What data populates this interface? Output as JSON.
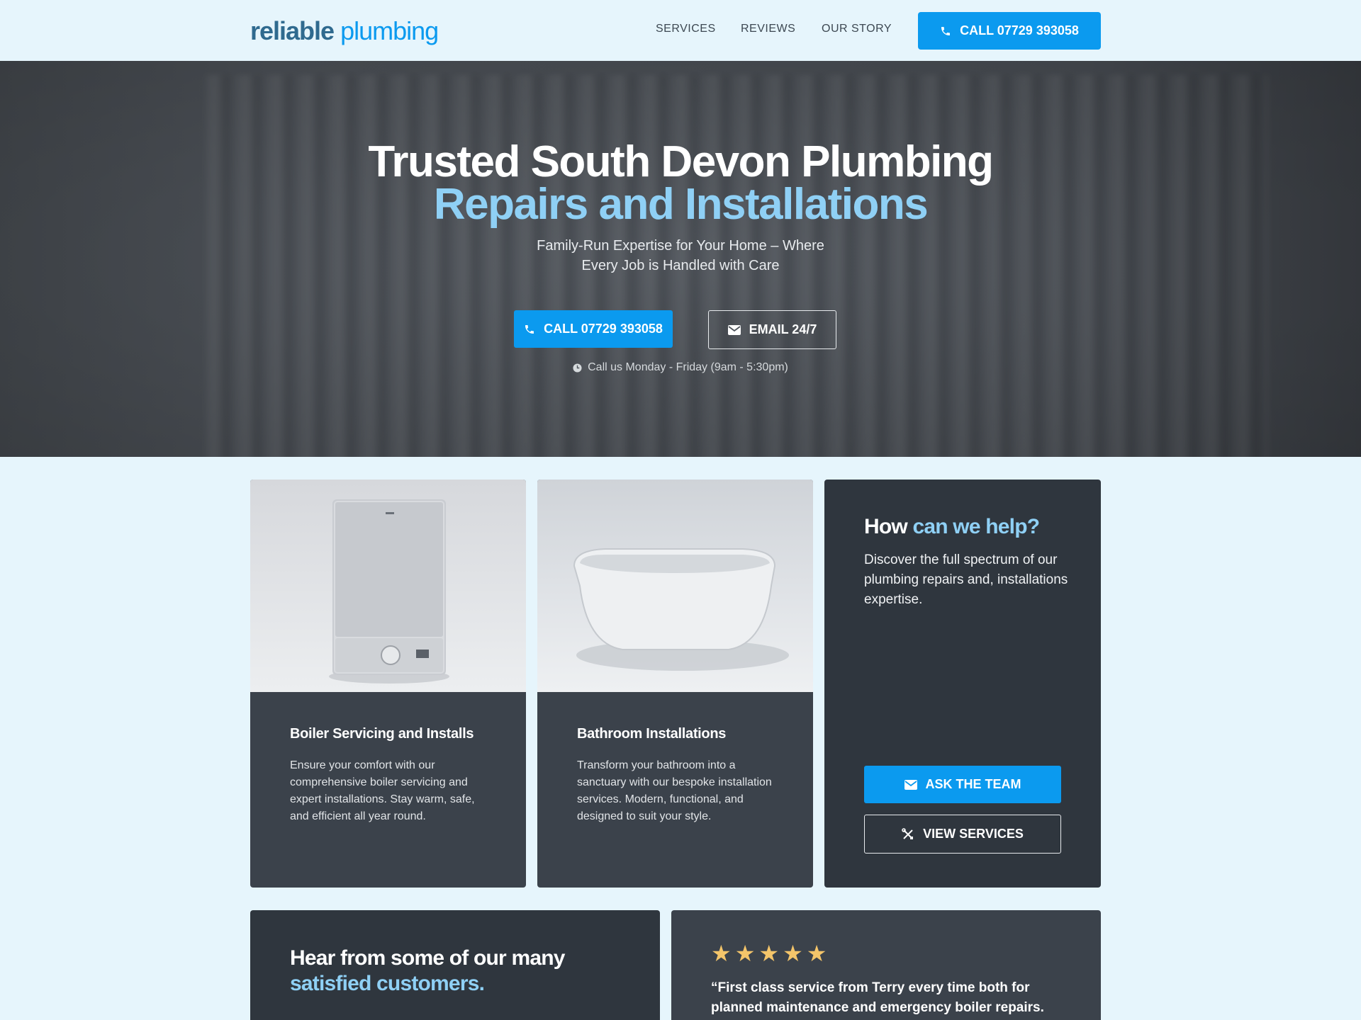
{
  "brand": {
    "logo_part1": "reliable",
    "logo_part2": "plumbing"
  },
  "nav": {
    "items": [
      "SERVICES",
      "REVIEWS",
      "OUR STORY"
    ],
    "call_label": "CALL 07729 393058"
  },
  "hero": {
    "title_line1": "Trusted South Devon Plumbing",
    "title_line2": "Repairs and Installations",
    "subtitle_line1": "Family-Run Expertise for Your Home – Where",
    "subtitle_line2": "Every Job is Handled with Care",
    "call_label": "CALL 07729 393058",
    "email_label": "EMAIL 24/7",
    "hours": "Call us Monday - Friday (9am - 5:30pm)"
  },
  "cards": [
    {
      "title": "Boiler Servicing and Installs",
      "text": "Ensure your comfort with our comprehensive boiler servicing and expert installations. Stay warm, safe, and efficient all year round."
    },
    {
      "title": "Bathroom Installations",
      "text": "Transform your bathroom into a sanctuary with our bespoke installation services. Modern, functional, and designed to suit your style."
    }
  ],
  "help": {
    "title_part1": "How ",
    "title_part2": "can we help?",
    "text": "Discover the full spectrum of our plumbing repairs and, installations expertise.",
    "ask_label": "ASK THE TEAM",
    "view_label": "VIEW SERVICES"
  },
  "testimonials": {
    "title_part1": "Hear from some of our many ",
    "title_part2": "satisfied customers.",
    "stars": "★★★★★",
    "rating": 5,
    "review": "“First class service from Terry every time both for planned maintenance and emergency boiler repairs."
  },
  "colors": {
    "accent": "#0b9aef",
    "accent_light": "#8fd0f5",
    "dark_card": "#3b424b",
    "darker_card": "#2f363e",
    "background": "#e6f5fc",
    "star": "#f4c56a"
  }
}
